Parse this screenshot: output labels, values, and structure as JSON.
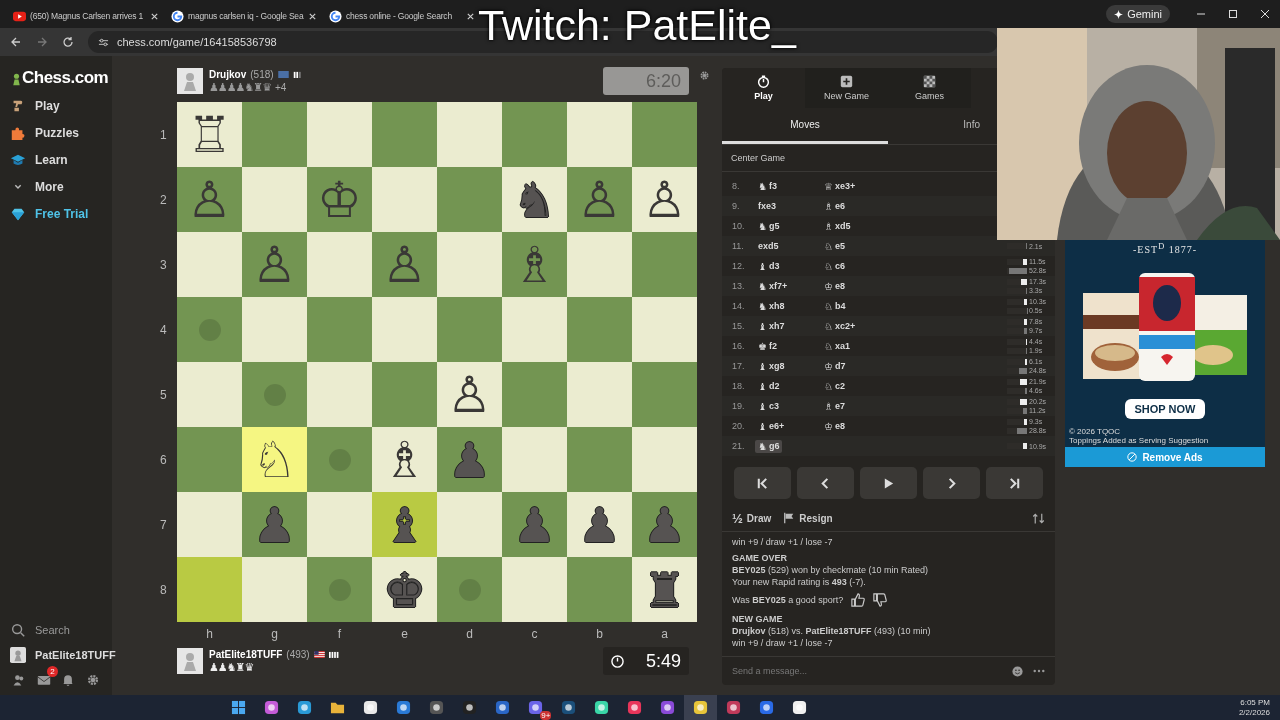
{
  "browser": {
    "tabs": [
      {
        "title": "(650) Magnus Carlsen arrives 1",
        "kind": "video",
        "selected": false
      },
      {
        "title": "magnus carlsen iq - Google Sea",
        "kind": "search",
        "selected": false
      },
      {
        "title": "chess online - Google Search",
        "kind": "search",
        "selected": false
      }
    ],
    "address": "chess.com/game/164158536798",
    "assistant": "Gemini"
  },
  "stream_overlay": {
    "text": "Twitch: PatElite_"
  },
  "sidebar": {
    "logo": "Chess.com",
    "items": [
      {
        "label": "Play",
        "kind": "play"
      },
      {
        "label": "Puzzles",
        "kind": "puzzles"
      },
      {
        "label": "Learn",
        "kind": "learn"
      },
      {
        "label": "More",
        "kind": "more"
      },
      {
        "label": "Free Trial",
        "kind": "trial"
      }
    ],
    "search": "Search",
    "user": "PatElite18TUFF",
    "mail_count": "2"
  },
  "game": {
    "top_player": {
      "name": "Drujkov",
      "rating": "(518)",
      "captured": "♟♟♟♟♞♜♛",
      "advantage": "+4",
      "clock": "6:20",
      "active": false
    },
    "bottom_player": {
      "name": "PatElite18TUFF",
      "rating": "(493)",
      "captured": "♟♟♞♜♛",
      "clock": "5:49",
      "active": true
    },
    "board": {
      "ranks": [
        "1",
        "2",
        "3",
        "4",
        "5",
        "6",
        "7",
        "8"
      ],
      "files": [
        "h",
        "g",
        "f",
        "e",
        "d",
        "c",
        "b",
        "a"
      ],
      "rows": [
        [
          {
            "piece": "♖",
            "kind": "white",
            "highlighted": false,
            "hint": false
          },
          {
            "highlighted": false,
            "hint": false
          },
          {
            "highlighted": false,
            "hint": false
          },
          {
            "highlighted": false,
            "hint": false
          },
          {
            "highlighted": false,
            "hint": false
          },
          {
            "highlighted": false,
            "hint": false
          },
          {
            "highlighted": false,
            "hint": false
          },
          {
            "highlighted": false,
            "hint": false
          }
        ],
        [
          {
            "piece": "♙",
            "kind": "white",
            "highlighted": false,
            "hint": false
          },
          {
            "highlighted": false,
            "hint": false
          },
          {
            "piece": "♔",
            "kind": "white",
            "highlighted": false,
            "hint": false
          },
          {
            "highlighted": false,
            "hint": false
          },
          {
            "highlighted": false,
            "hint": false
          },
          {
            "piece": "♞",
            "kind": "black",
            "highlighted": false,
            "hint": false
          },
          {
            "piece": "♙",
            "kind": "white",
            "highlighted": false,
            "hint": false
          },
          {
            "piece": "♙",
            "kind": "white",
            "highlighted": false,
            "hint": false
          }
        ],
        [
          {
            "highlighted": false,
            "hint": false
          },
          {
            "piece": "♙",
            "kind": "white",
            "highlighted": false,
            "hint": false
          },
          {
            "highlighted": false,
            "hint": false
          },
          {
            "piece": "♙",
            "kind": "white",
            "highlighted": false,
            "hint": false
          },
          {
            "highlighted": false,
            "hint": false
          },
          {
            "piece": "♗",
            "kind": "white",
            "highlighted": false,
            "hint": false
          },
          {
            "highlighted": false,
            "hint": false
          },
          {
            "highlighted": false,
            "hint": false
          }
        ],
        [
          {
            "highlighted": false,
            "hint": true
          },
          {
            "highlighted": false,
            "hint": false
          },
          {
            "highlighted": false,
            "hint": false
          },
          {
            "highlighted": false,
            "hint": false
          },
          {
            "highlighted": false,
            "hint": false
          },
          {
            "highlighted": false,
            "hint": false
          },
          {
            "highlighted": false,
            "hint": false
          },
          {
            "highlighted": false,
            "hint": false
          }
        ],
        [
          {
            "highlighted": false,
            "hint": false
          },
          {
            "highlighted": false,
            "hint": true
          },
          {
            "highlighted": false,
            "hint": false
          },
          {
            "highlighted": false,
            "hint": false
          },
          {
            "piece": "♙",
            "kind": "white",
            "highlighted": false,
            "hint": false
          },
          {
            "highlighted": false,
            "hint": false
          },
          {
            "highlighted": false,
            "hint": false
          },
          {
            "highlighted": false,
            "hint": false
          }
        ],
        [
          {
            "highlighted": false,
            "hint": false
          },
          {
            "piece": "♘",
            "kind": "white",
            "highlighted": true,
            "hint": false
          },
          {
            "highlighted": false,
            "hint": true
          },
          {
            "piece": "♗",
            "kind": "white",
            "highlighted": false,
            "hint": false
          },
          {
            "piece": "♟",
            "kind": "black",
            "highlighted": false,
            "hint": false
          },
          {
            "highlighted": false,
            "hint": false
          },
          {
            "highlighted": false,
            "hint": false
          },
          {
            "highlighted": false,
            "hint": false
          }
        ],
        [
          {
            "highlighted": false,
            "hint": false
          },
          {
            "piece": "♟",
            "kind": "black",
            "highlighted": false,
            "hint": false
          },
          {
            "highlighted": false,
            "hint": false
          },
          {
            "piece": "♝",
            "kind": "black",
            "highlighted": true,
            "hint": false
          },
          {
            "highlighted": false,
            "hint": false
          },
          {
            "piece": "♟",
            "kind": "black",
            "highlighted": false,
            "hint": false
          },
          {
            "piece": "♟",
            "kind": "black",
            "highlighted": false,
            "hint": false
          },
          {
            "piece": "♟",
            "kind": "black",
            "highlighted": false,
            "hint": false
          }
        ],
        [
          {
            "highlighted": true,
            "hint": false
          },
          {
            "highlighted": false,
            "hint": false
          },
          {
            "highlighted": false,
            "hint": true
          },
          {
            "piece": "♚",
            "kind": "black",
            "highlighted": false,
            "hint": false
          },
          {
            "highlighted": false,
            "hint": true
          },
          {
            "highlighted": false,
            "hint": false
          },
          {
            "highlighted": false,
            "hint": false
          },
          {
            "piece": "♜",
            "kind": "black",
            "highlighted": false,
            "hint": false
          }
        ]
      ]
    }
  },
  "panel": {
    "tabs": [
      {
        "label": "Play",
        "kind": "timer",
        "selected": true
      },
      {
        "label": "New Game",
        "kind": "plus",
        "selected": false
      },
      {
        "label": "Games",
        "kind": "board",
        "selected": false
      }
    ],
    "subtabs": [
      {
        "label": "Moves",
        "selected": true
      },
      {
        "label": "Info",
        "selected": false
      }
    ],
    "opening": "Center Game",
    "moves": [
      {
        "number": "8.",
        "white": {
          "figure": "♞",
          "san": "f3",
          "selected": false
        },
        "black": {
          "figure": "♕",
          "san": "xe3+",
          "selected": false
        }
      },
      {
        "number": "9.",
        "white": {
          "san": "fxe3",
          "selected": false
        },
        "black": {
          "figure": "♗",
          "san": "e6",
          "selected": false
        }
      },
      {
        "number": "10.",
        "white": {
          "figure": "♞",
          "san": "g5",
          "selected": false
        },
        "black": {
          "figure": "♗",
          "san": "xd5",
          "selected": false
        }
      },
      {
        "number": "11.",
        "white": {
          "san": "exd5",
          "selected": false
        },
        "black": {
          "figure": "♘",
          "san": "e5",
          "selected": false
        },
        "black_time": {
          "text": "2.1s",
          "level": 0.04
        }
      },
      {
        "number": "12.",
        "white": {
          "figure": "♝",
          "san": "d3",
          "selected": false
        },
        "black": {
          "figure": "♘",
          "san": "c6",
          "selected": false
        },
        "white_time": {
          "text": "11.5s",
          "level": 0.19
        },
        "black_time": {
          "text": "52.8s",
          "level": 0.88
        }
      },
      {
        "number": "13.",
        "white": {
          "figure": "♞",
          "san": "xf7+",
          "selected": false
        },
        "black": {
          "figure": "♔",
          "san": "e8",
          "selected": false
        },
        "white_time": {
          "text": "17.3s",
          "level": 0.29
        },
        "black_time": {
          "text": "3.3s",
          "level": 0.06
        }
      },
      {
        "number": "14.",
        "white": {
          "figure": "♞",
          "san": "xh8",
          "selected": false
        },
        "black": {
          "figure": "♘",
          "san": "b4",
          "selected": false
        },
        "white_time": {
          "text": "10.3s",
          "level": 0.17
        },
        "black_time": {
          "text": "0.5s",
          "level": 0.01
        }
      },
      {
        "number": "15.",
        "white": {
          "figure": "♝",
          "san": "xh7",
          "selected": false
        },
        "black": {
          "figure": "♘",
          "san": "xc2+",
          "selected": false
        },
        "white_time": {
          "text": "7.8s",
          "level": 0.13
        },
        "black_time": {
          "text": "9.7s",
          "level": 0.16
        }
      },
      {
        "number": "16.",
        "white": {
          "figure": "♚",
          "san": "f2",
          "selected": false
        },
        "black": {
          "figure": "♘",
          "san": "xa1",
          "selected": false
        },
        "white_time": {
          "text": "4.4s",
          "level": 0.07
        },
        "black_time": {
          "text": "1.9s",
          "level": 0.03
        }
      },
      {
        "number": "17.",
        "white": {
          "figure": "♝",
          "san": "xg8",
          "selected": false
        },
        "black": {
          "figure": "♔",
          "san": "d7",
          "selected": false
        },
        "white_time": {
          "text": "6.1s",
          "level": 0.1
        },
        "black_time": {
          "text": "24.8s",
          "level": 0.41
        }
      },
      {
        "number": "18.",
        "white": {
          "figure": "♝",
          "san": "d2",
          "selected": false
        },
        "black": {
          "figure": "♘",
          "san": "c2",
          "selected": false
        },
        "white_time": {
          "text": "21.9s",
          "level": 0.37
        },
        "black_time": {
          "text": "4.6s",
          "level": 0.08
        }
      },
      {
        "number": "19.",
        "white": {
          "figure": "♝",
          "san": "c3",
          "selected": false
        },
        "black": {
          "figure": "♗",
          "san": "e7",
          "selected": false
        },
        "white_time": {
          "text": "20.2s",
          "level": 0.34
        },
        "black_time": {
          "text": "11.2s",
          "level": 0.19
        }
      },
      {
        "number": "20.",
        "white": {
          "figure": "♝",
          "san": "e6+",
          "selected": false
        },
        "black": {
          "figure": "♔",
          "san": "e8",
          "selected": false
        },
        "white_time": {
          "text": "9.3s",
          "level": 0.16
        },
        "black_time": {
          "text": "28.8s",
          "level": 0.48
        }
      },
      {
        "number": "21.",
        "white": {
          "figure": "♞",
          "san": "g6",
          "selected": true
        },
        "white_time": {
          "text": "10.9s",
          "level": 0.18
        }
      }
    ],
    "controls": [
      {
        "kind": "first"
      },
      {
        "kind": "previous"
      },
      {
        "kind": "play"
      },
      {
        "kind": "next"
      },
      {
        "kind": "last"
      }
    ],
    "actions": [
      {
        "kind": "draw",
        "icon": "½",
        "label": "Draw"
      },
      {
        "kind": "resign",
        "label": "Resign"
      }
    ],
    "chat": [
      {
        "kind": "plain",
        "text": "win +9 / draw +1 / lose -7"
      },
      {
        "kind": "heading",
        "text": "GAME OVER"
      },
      {
        "kind": "plain",
        "text": "**BEY025** (529) won by checkmate (10 min Rated)"
      },
      {
        "kind": "plain",
        "text": "Your new Rapid rating is **493** (-7)."
      },
      {
        "kind": "sport",
        "text": "Was **BEY025** a good sport?"
      },
      {
        "kind": "heading",
        "text": "NEW GAME"
      },
      {
        "kind": "plain",
        "text": "**Drujkov** (518) vs. **PatElite18TUFF** (493) (10 min)"
      },
      {
        "kind": "plain",
        "text": "win +9 / draw +1 / lose -7"
      }
    ],
    "message_placeholder": "Send a message..."
  },
  "ad": {
    "established": "-EST$^{D}$ 1877-",
    "cta": "SHOP NOW",
    "copyright": "© 2026 TQOC",
    "disclaimer": "Toppings Added as Serving Suggestion",
    "remove": "Remove Ads"
  },
  "taskbar": {
    "apps": [
      {
        "kind": "windows",
        "selected": false
      },
      {
        "kind": "copilot",
        "selected": false
      },
      {
        "kind": "edge",
        "selected": false
      },
      {
        "kind": "folder",
        "selected": false
      },
      {
        "kind": "store",
        "selected": false
      },
      {
        "kind": "mail",
        "selected": false
      },
      {
        "kind": "obs",
        "selected": false
      },
      {
        "kind": "epic",
        "selected": false
      },
      {
        "kind": "arc",
        "selected": false
      },
      {
        "kind": "chat",
        "selected": false,
        "badge": "9+"
      },
      {
        "kind": "steam",
        "selected": false
      },
      {
        "kind": "robot",
        "selected": false
      },
      {
        "kind": "tiktok",
        "selected": false
      },
      {
        "kind": "audio",
        "selected": false
      },
      {
        "kind": "chrome",
        "selected": true
      },
      {
        "kind": "tf",
        "selected": false
      },
      {
        "kind": "plus",
        "selected": false
      },
      {
        "kind": "robot-white",
        "selected": false
      }
    ],
    "time": "6:05 PM",
    "date": "2/2/2026"
  }
}
